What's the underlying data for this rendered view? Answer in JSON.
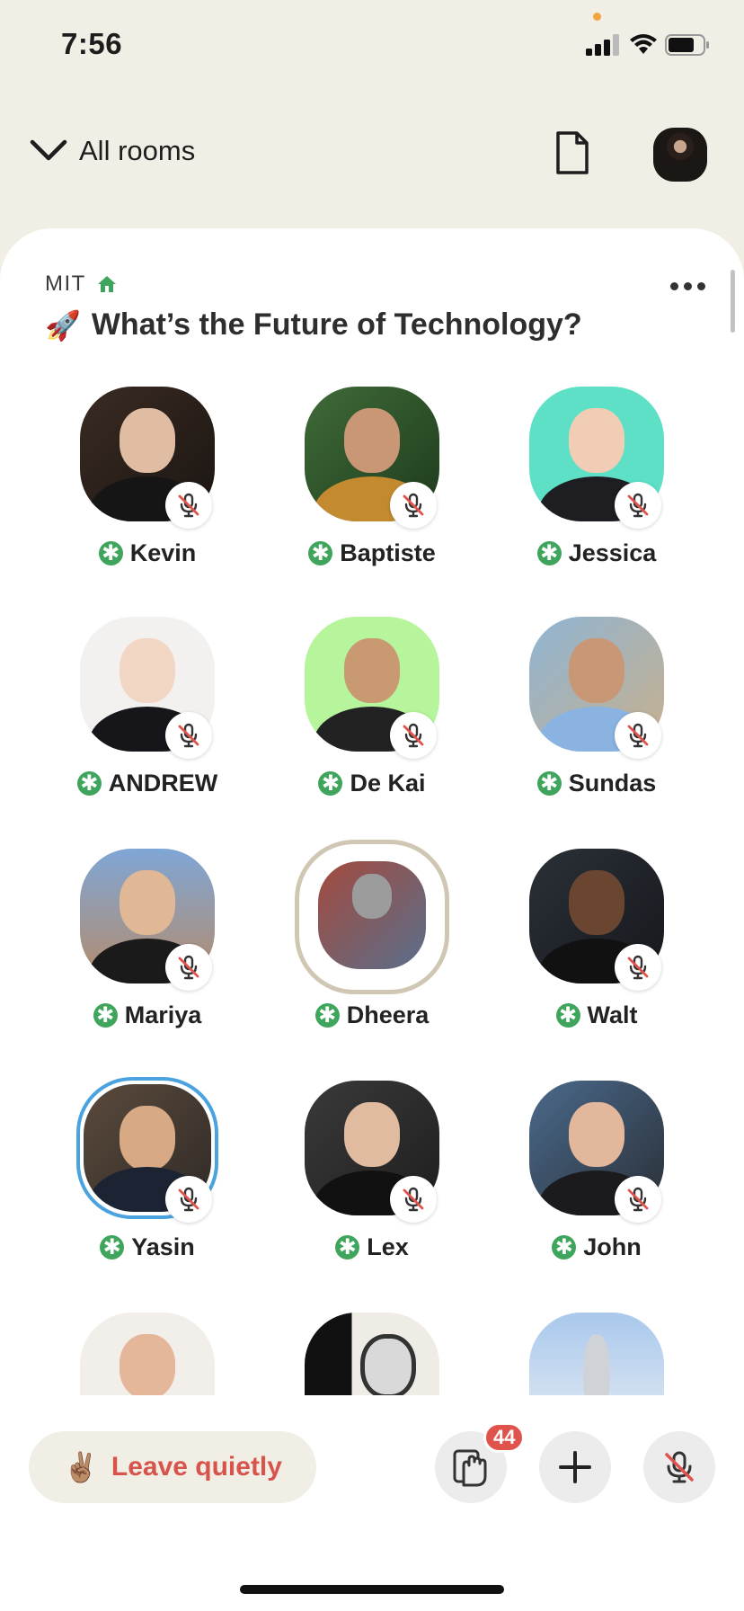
{
  "status_bar": {
    "time": "7:56"
  },
  "header": {
    "back_label": "All rooms"
  },
  "room": {
    "club": "MIT",
    "emoji": "🚀",
    "title": "What’s the Future of Technology?"
  },
  "speakers": [
    {
      "name": "Kevin"
    },
    {
      "name": "Baptiste"
    },
    {
      "name": "Jessica"
    },
    {
      "name": "ANDREW"
    },
    {
      "name": "De Kai"
    },
    {
      "name": "Sundas"
    },
    {
      "name": "Mariya"
    },
    {
      "name": "Dheera"
    },
    {
      "name": "Walt"
    },
    {
      "name": "Yasin"
    },
    {
      "name": "Lex"
    },
    {
      "name": "John"
    }
  ],
  "bottom_bar": {
    "leave_emoji": "✌🏽",
    "leave_label": "Leave quietly",
    "raise_hand_count": "44"
  },
  "colors": {
    "background": "#f1efe5",
    "moderator_green": "#3fa55c",
    "leave_red": "#d7534c",
    "badge_red": "#e0534c",
    "speaking_blue": "#4aa3df"
  },
  "icons": [
    "signal-icon",
    "wifi-icon",
    "battery-icon",
    "chevron-down-icon",
    "document-icon",
    "house-icon",
    "more-icon",
    "mic-muted-icon",
    "moderator-icon",
    "raise-hand-icon",
    "plus-icon"
  ]
}
